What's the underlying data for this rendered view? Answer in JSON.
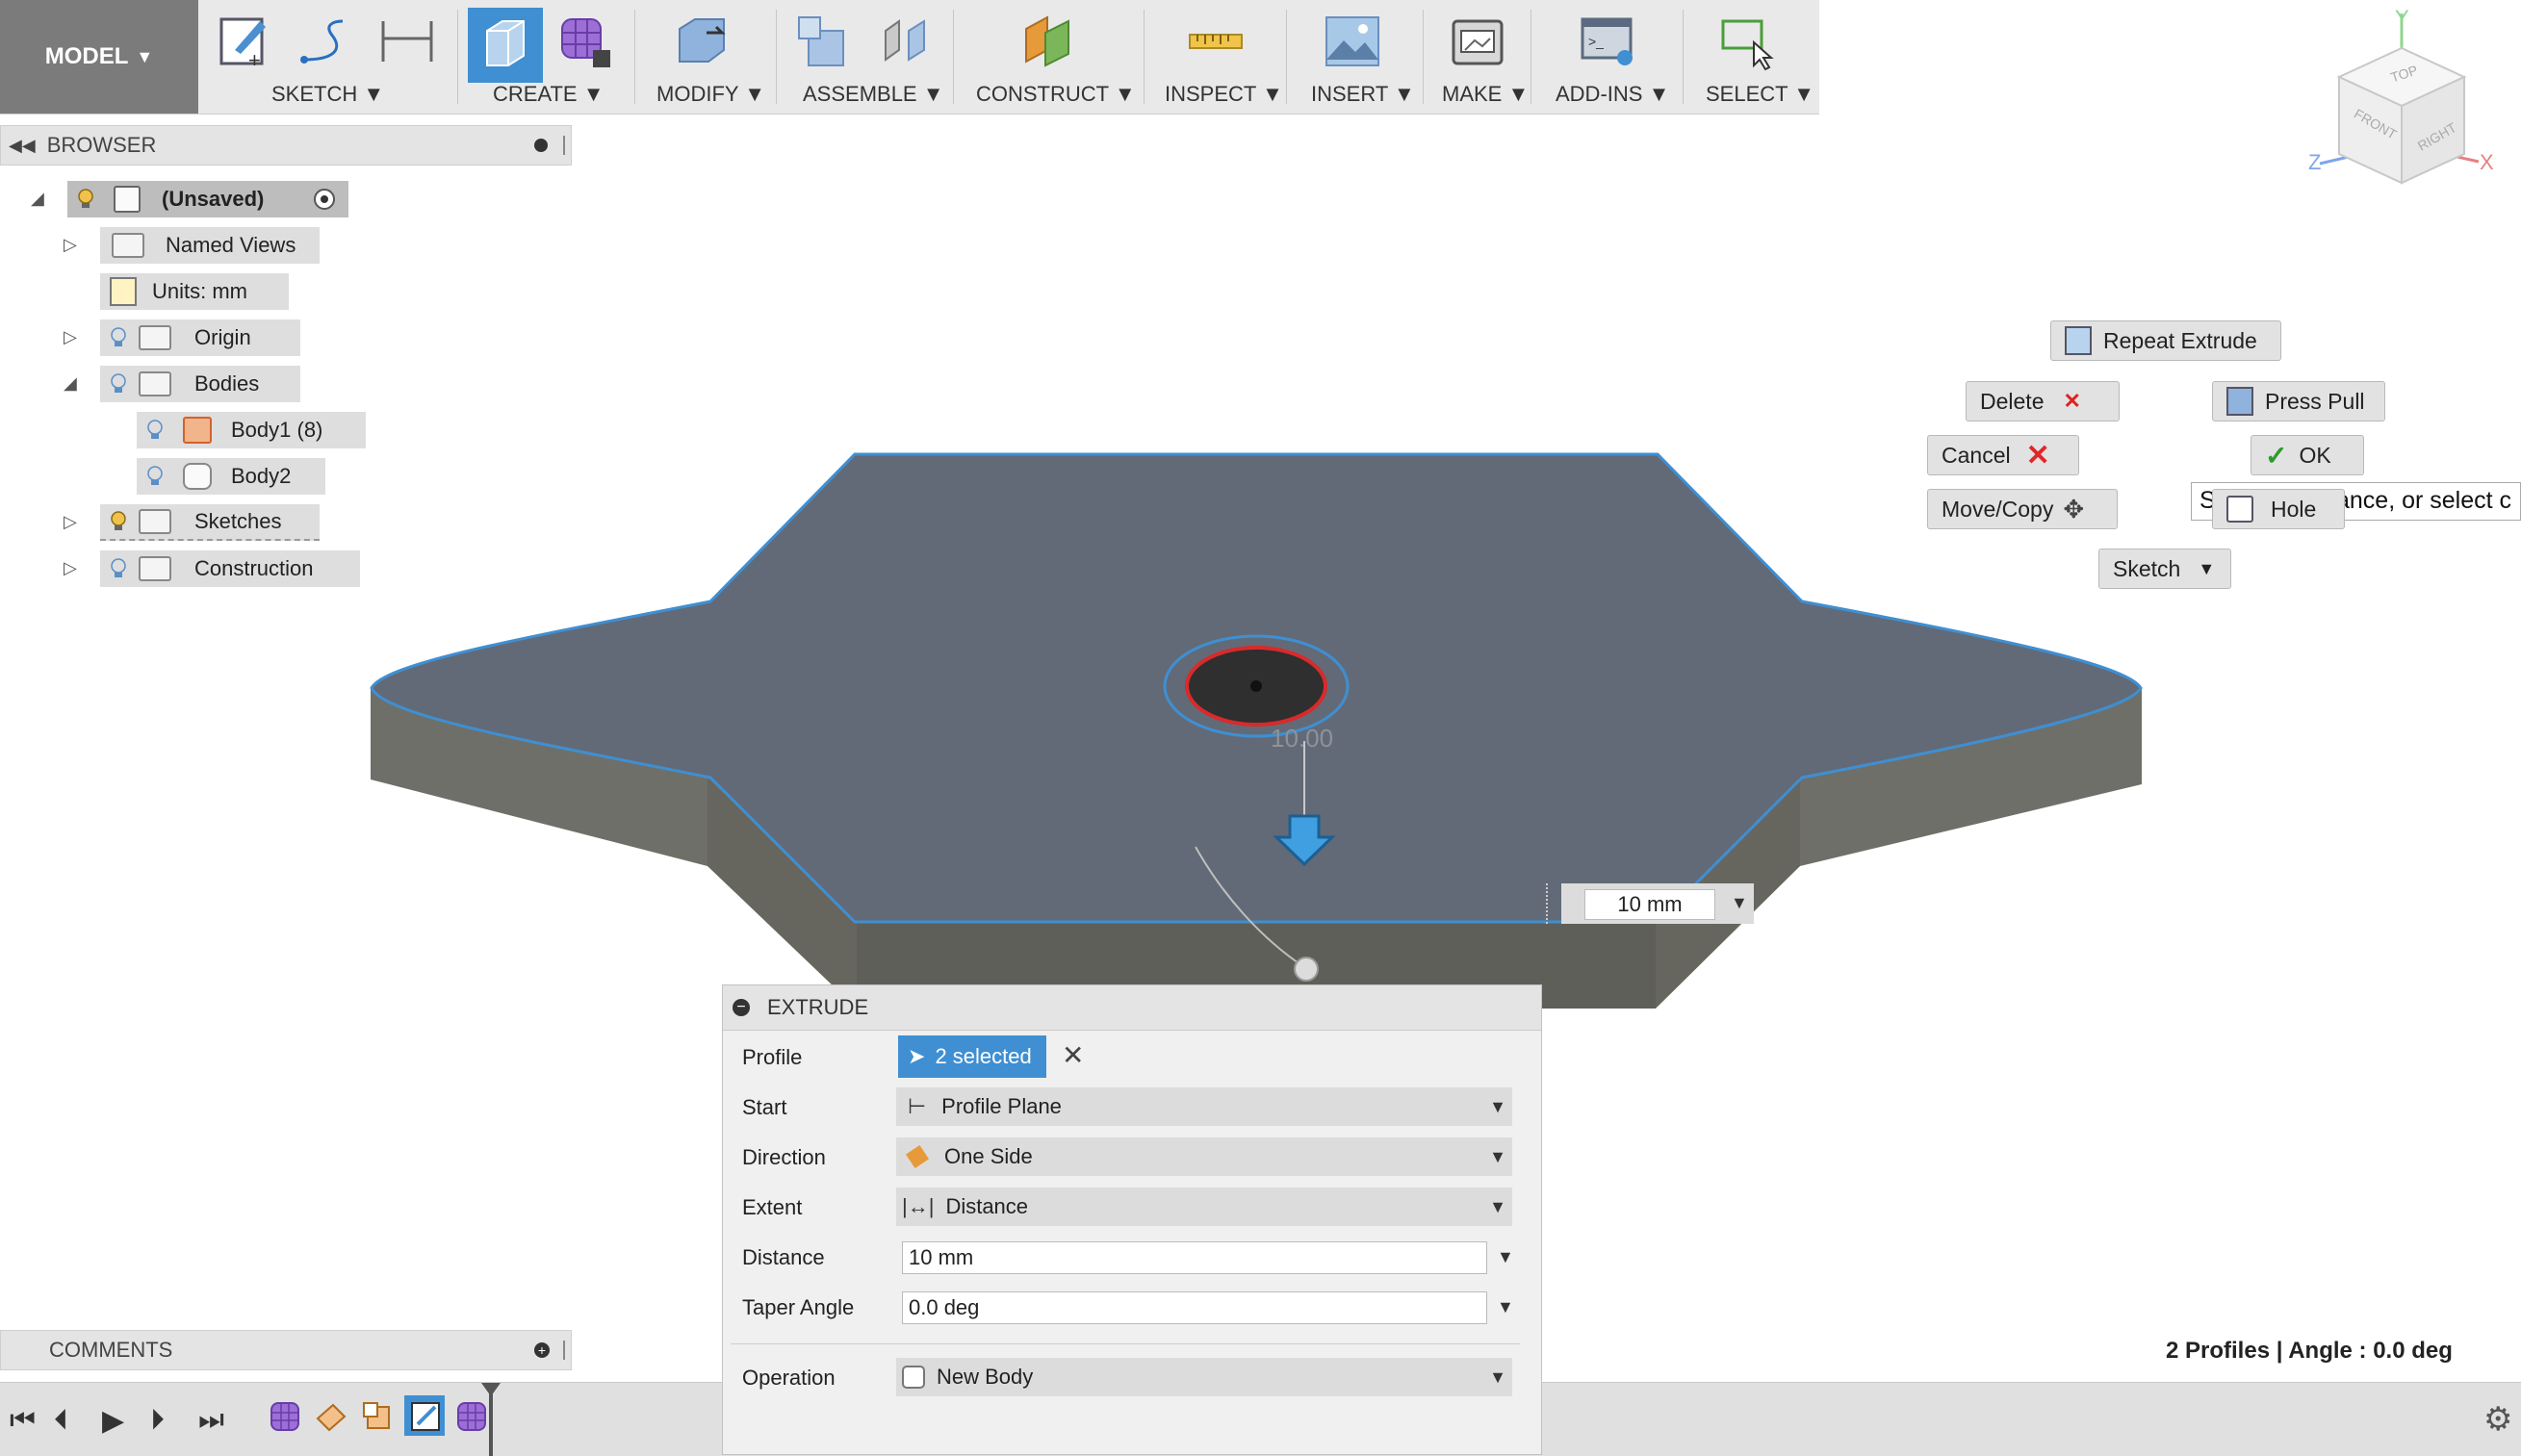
{
  "toolbar": {
    "mode": "MODEL",
    "groups": [
      "SKETCH",
      "CREATE",
      "MODIFY",
      "ASSEMBLE",
      "CONSTRUCT",
      "INSPECT",
      "INSERT",
      "MAKE",
      "ADD-INS",
      "SELECT"
    ]
  },
  "browser": {
    "title": "BROWSER",
    "items": [
      {
        "label": "(Unsaved)"
      },
      {
        "label": "Named Views"
      },
      {
        "label": "Units: mm"
      },
      {
        "label": "Origin"
      },
      {
        "label": "Bodies"
      },
      {
        "label": "Body1 (8)"
      },
      {
        "label": "Body2"
      },
      {
        "label": "Sketches"
      },
      {
        "label": "Construction"
      }
    ]
  },
  "comments": {
    "title": "COMMENTS"
  },
  "viewcube": {
    "top": "TOP",
    "front": "FRONT",
    "right": "RIGHT",
    "axis_x": "X",
    "axis_y": "Y",
    "axis_z": "Z"
  },
  "viewport": {
    "dimension_label": "10.00",
    "distance_value": "10 mm",
    "status": "2 Profiles | Angle : 0.0 deg",
    "tooltip_fragment": "S",
    "tooltip_text": "ance, or select c"
  },
  "context_menu": {
    "repeat": "Repeat Extrude",
    "delete": "Delete",
    "press_pull": "Press Pull",
    "cancel": "Cancel",
    "ok": "OK",
    "move_copy": "Move/Copy",
    "hole": "Hole",
    "sketch": "Sketch"
  },
  "extrude": {
    "title": "EXTRUDE",
    "rows": {
      "profile": {
        "label": "Profile",
        "value": "2 selected"
      },
      "start": {
        "label": "Start",
        "value": "Profile Plane"
      },
      "direction": {
        "label": "Direction",
        "value": "One Side"
      },
      "extent": {
        "label": "Extent",
        "value": "Distance"
      },
      "distance": {
        "label": "Distance",
        "value": "10 mm"
      },
      "taper": {
        "label": "Taper Angle",
        "value": "0.0 deg"
      },
      "operation": {
        "label": "Operation",
        "value": "New Body"
      }
    }
  },
  "colors": {
    "accent": "#3f8fd2",
    "face": "#626a77",
    "side": "#6e6e68",
    "profile_red": "#d92a2a"
  }
}
